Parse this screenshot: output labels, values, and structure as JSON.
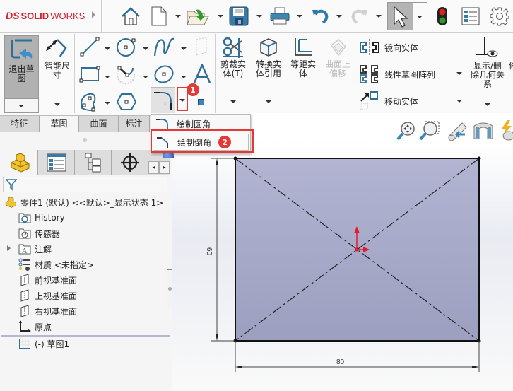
{
  "app": {
    "brand": "SOLIDWORKS",
    "brand_prefix": "DS",
    "brand_bold": "SOLID",
    "brand_light": "WORKS"
  },
  "quick_access": {
    "icons": [
      "home-icon",
      "new-document-icon",
      "open-folder-icon",
      "save-icon",
      "print-icon",
      "undo-icon",
      "redo-icon",
      "select-arrow-icon",
      "rebuild-traffic-light-icon",
      "file-properties-icon",
      "options-gear-icon"
    ]
  },
  "ribbon": {
    "exit_sketch": "退出草图",
    "smart_dimension": "智能尺寸",
    "trim": "剪裁实体(T)",
    "convert": "转换实体引用",
    "offset": "等距实体",
    "surface_offset": "曲面上偏移",
    "mirror": "镜向实体",
    "linear_pattern": "线性草图阵列",
    "move": "移动实体",
    "relations": "显示/删除几何关系",
    "relations_partial": "修"
  },
  "tabs": [
    {
      "label": "特征",
      "active": false
    },
    {
      "label": "草图",
      "active": true
    },
    {
      "label": "曲面",
      "active": false
    },
    {
      "label": "标注",
      "active": false
    }
  ],
  "dropdown_menu": {
    "items": [
      {
        "label": "绘制圆角",
        "highlighted": false
      },
      {
        "label": "绘制倒角",
        "highlighted": true
      }
    ]
  },
  "annotations": {
    "step1": "1",
    "step2": "2",
    "highlight_color": "#e53935"
  },
  "feature_tree": {
    "root": "零件1 (默认) <<默认>_显示状态 1>",
    "items": [
      {
        "label": "History",
        "icon": "history-folder-icon"
      },
      {
        "label": "传感器",
        "icon": "sensors-folder-icon"
      },
      {
        "label": "注解",
        "icon": "annotations-folder-icon",
        "expandable": true
      },
      {
        "label": "材质 <未指定>",
        "icon": "material-icon"
      },
      {
        "label": "前视基准面",
        "icon": "plane-icon"
      },
      {
        "label": "上视基准面",
        "icon": "plane-icon"
      },
      {
        "label": "右视基准面",
        "icon": "plane-icon"
      },
      {
        "label": "原点",
        "icon": "origin-icon"
      },
      {
        "label": "(-) 草图1",
        "icon": "sketch-icon"
      }
    ]
  },
  "sketch": {
    "width_dim": "80",
    "height_dim": "60",
    "fill_color": "#a9abcb",
    "origin_color": "#e8192c"
  }
}
